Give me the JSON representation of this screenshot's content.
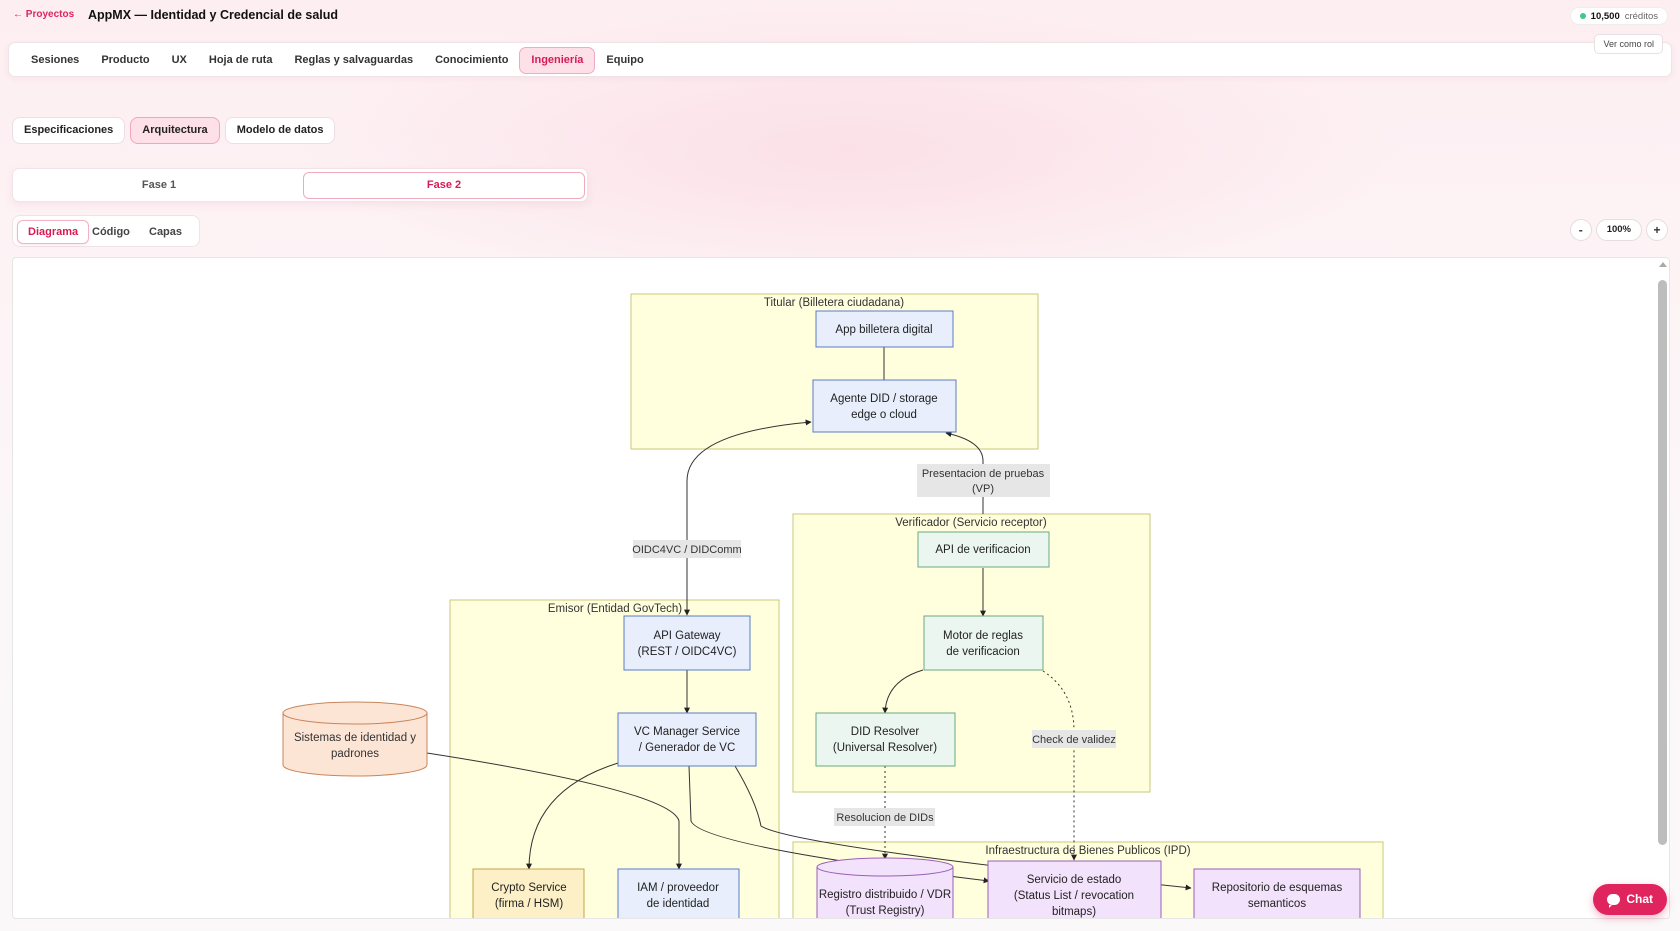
{
  "header": {
    "back_label": "← Proyectos",
    "title": "AppMX — Identidad y Credencial de salud",
    "credits_value": "10,500",
    "credits_label": "créditos"
  },
  "nav": {
    "items": [
      "Sesiones",
      "Producto",
      "UX",
      "Hoja de ruta",
      "Reglas y salvaguardas",
      "Conocimiento",
      "Ingeniería",
      "Equipo"
    ],
    "active": "Ingeniería",
    "role_button": "Ver como rol"
  },
  "subtabs": {
    "items": [
      "Especificaciones",
      "Arquitectura",
      "Modelo de datos"
    ],
    "active": "Arquitectura"
  },
  "phases": {
    "items": [
      "Fase 1",
      "Fase 2"
    ],
    "active": "Fase 2"
  },
  "view_tabs": {
    "items": [
      "Diagrama",
      "Código",
      "Capas"
    ],
    "active": "Diagrama"
  },
  "zoom": {
    "minus": "-",
    "value": "100%",
    "plus": "+"
  },
  "chat": {
    "label": "Chat"
  },
  "diagram": {
    "groups": {
      "titular": "Titular (Billetera ciudadana)",
      "verificador": "Verificador (Servicio receptor)",
      "emisor": "Emisor (Entidad GovTech)",
      "ipd": "Infraestructura de Bienes Publicos (IPD)"
    },
    "nodes": {
      "app_billetera": [
        "App billetera digital"
      ],
      "agente_did": [
        "Agente DID / storage",
        "edge o cloud"
      ],
      "api_verificacion": [
        "API de verificacion"
      ],
      "motor_reglas": [
        "Motor de reglas",
        "de verificacion"
      ],
      "did_resolver": [
        "DID Resolver",
        "(Universal Resolver)"
      ],
      "api_gateway": [
        "API Gateway",
        "(REST / OIDC4VC)"
      ],
      "vc_manager": [
        "VC Manager Service",
        "/ Generador de VC"
      ],
      "sistemas_identidad": [
        "Sistemas de identidad y",
        "padrones"
      ],
      "crypto_service": [
        "Crypto Service",
        "(firma / HSM)"
      ],
      "iam": [
        "IAM / proveedor",
        "de identidad"
      ],
      "registro": [
        "Registro distribuido / VDR",
        "(Trust Registry)"
      ],
      "servicio_estado": [
        "Servicio de estado",
        "(Status List / revocation",
        "bitmaps)"
      ],
      "repositorio": [
        "Repositorio de esquemas",
        "semanticos"
      ]
    },
    "edge_labels": {
      "presentacion": [
        "Presentacion de pruebas",
        "(VP)"
      ],
      "oidc": [
        "OIDC4VC / DIDComm"
      ],
      "check": [
        "Check de validez"
      ],
      "resolucion": [
        "Resolucion de DIDs"
      ]
    }
  },
  "colors": {
    "accent": "#e0245e",
    "group_fill": "#ffffde",
    "group_stroke": "#c9c97a",
    "blue_fill": "#e8eefc",
    "blue_stroke": "#5a7cc9",
    "green_fill": "#eaf6ef",
    "green_stroke": "#6aaa80",
    "purple_fill": "#f3e2fb",
    "purple_stroke": "#9a5fb8",
    "orange_fill": "#fde5d6",
    "orange_stroke": "#c9845a",
    "yellow_fill": "#fdf0c6",
    "yellow_stroke": "#c2a34a"
  }
}
